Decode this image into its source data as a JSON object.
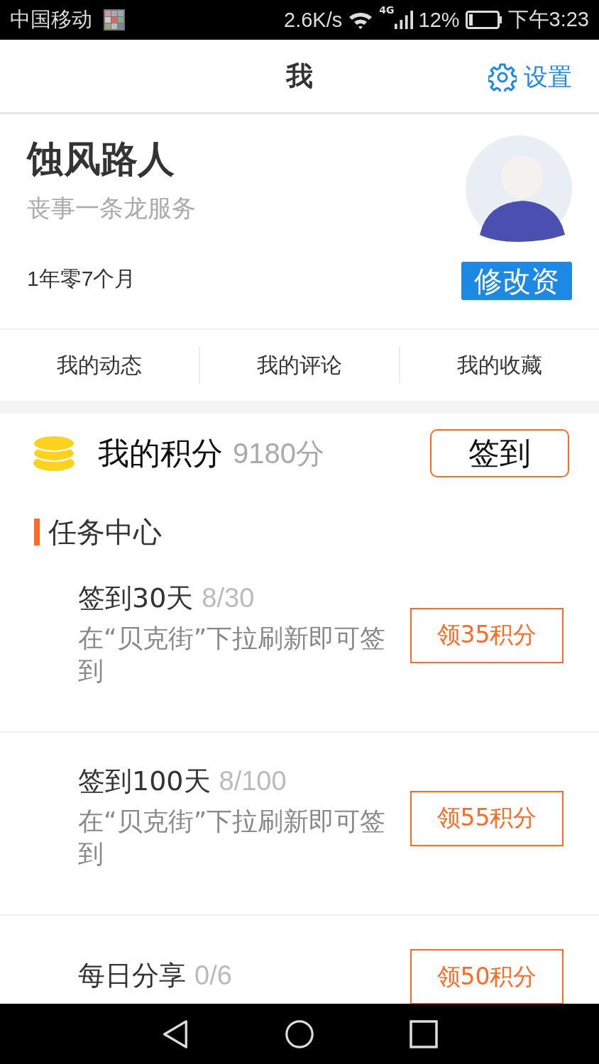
{
  "status_bar": {
    "carrier": "中国移动",
    "speed": "2.6K/s",
    "network": "4G",
    "battery": "12%",
    "time": "下午3:23"
  },
  "header": {
    "title": "我",
    "settings": "设置"
  },
  "profile": {
    "name": "蚀风路人",
    "bio": "丧事一条龙服务",
    "age": "1年零7个月",
    "edit_button": "修改资"
  },
  "tabs": [
    {
      "label": "我的动态"
    },
    {
      "label": "我的评论"
    },
    {
      "label": "我的收藏"
    }
  ],
  "points": {
    "label": "我的积分",
    "value": "9180分",
    "checkin_button": "签到"
  },
  "task_center": {
    "title": "任务中心",
    "tasks": [
      {
        "title": "签到30天",
        "progress": "8/30",
        "description": "在“贝克街”下拉刷新即可签到",
        "button": "领35积分"
      },
      {
        "title": "签到100天",
        "progress": "8/100",
        "description": "在“贝克街”下拉刷新即可签到",
        "button": "领55积分"
      },
      {
        "title": "每日分享",
        "progress": "0/6",
        "button": "领50积分"
      }
    ]
  }
}
